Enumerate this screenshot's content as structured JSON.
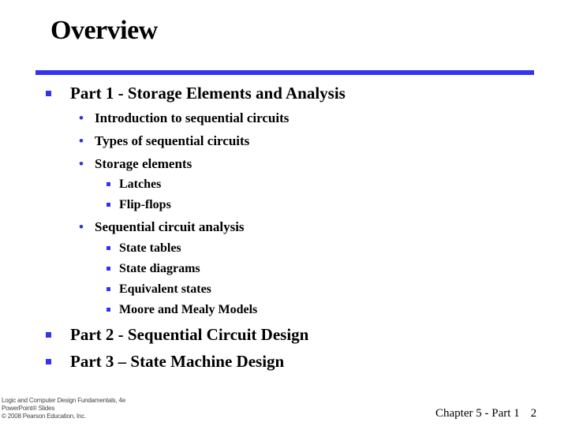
{
  "slide": {
    "title": "Overview",
    "accent_color": "#3333ee",
    "items": [
      {
        "label": "Part 1 - Storage Elements and Analysis",
        "children": [
          {
            "label": "Introduction to sequential circuits"
          },
          {
            "label": "Types of sequential circuits"
          },
          {
            "label": "Storage elements",
            "children": [
              {
                "label": "Latches"
              },
              {
                "label": "Flip-flops"
              }
            ]
          },
          {
            "label": "Sequential circuit analysis",
            "children": [
              {
                "label": "State tables"
              },
              {
                "label": "State diagrams"
              },
              {
                "label": "Equivalent states"
              },
              {
                "label": "Moore and Mealy Models"
              }
            ]
          }
        ]
      },
      {
        "label": "Part 2 - Sequential Circuit Design"
      },
      {
        "label": "Part 3 – State Machine Design"
      }
    ]
  },
  "footer": {
    "copyright_lines": [
      "Logic and Computer Design Fundamentals, 4e",
      "PowerPoint® Slides",
      "© 2008 Pearson Education, Inc."
    ],
    "chapter": "Chapter 5 - Part 1",
    "page_number": "2"
  }
}
